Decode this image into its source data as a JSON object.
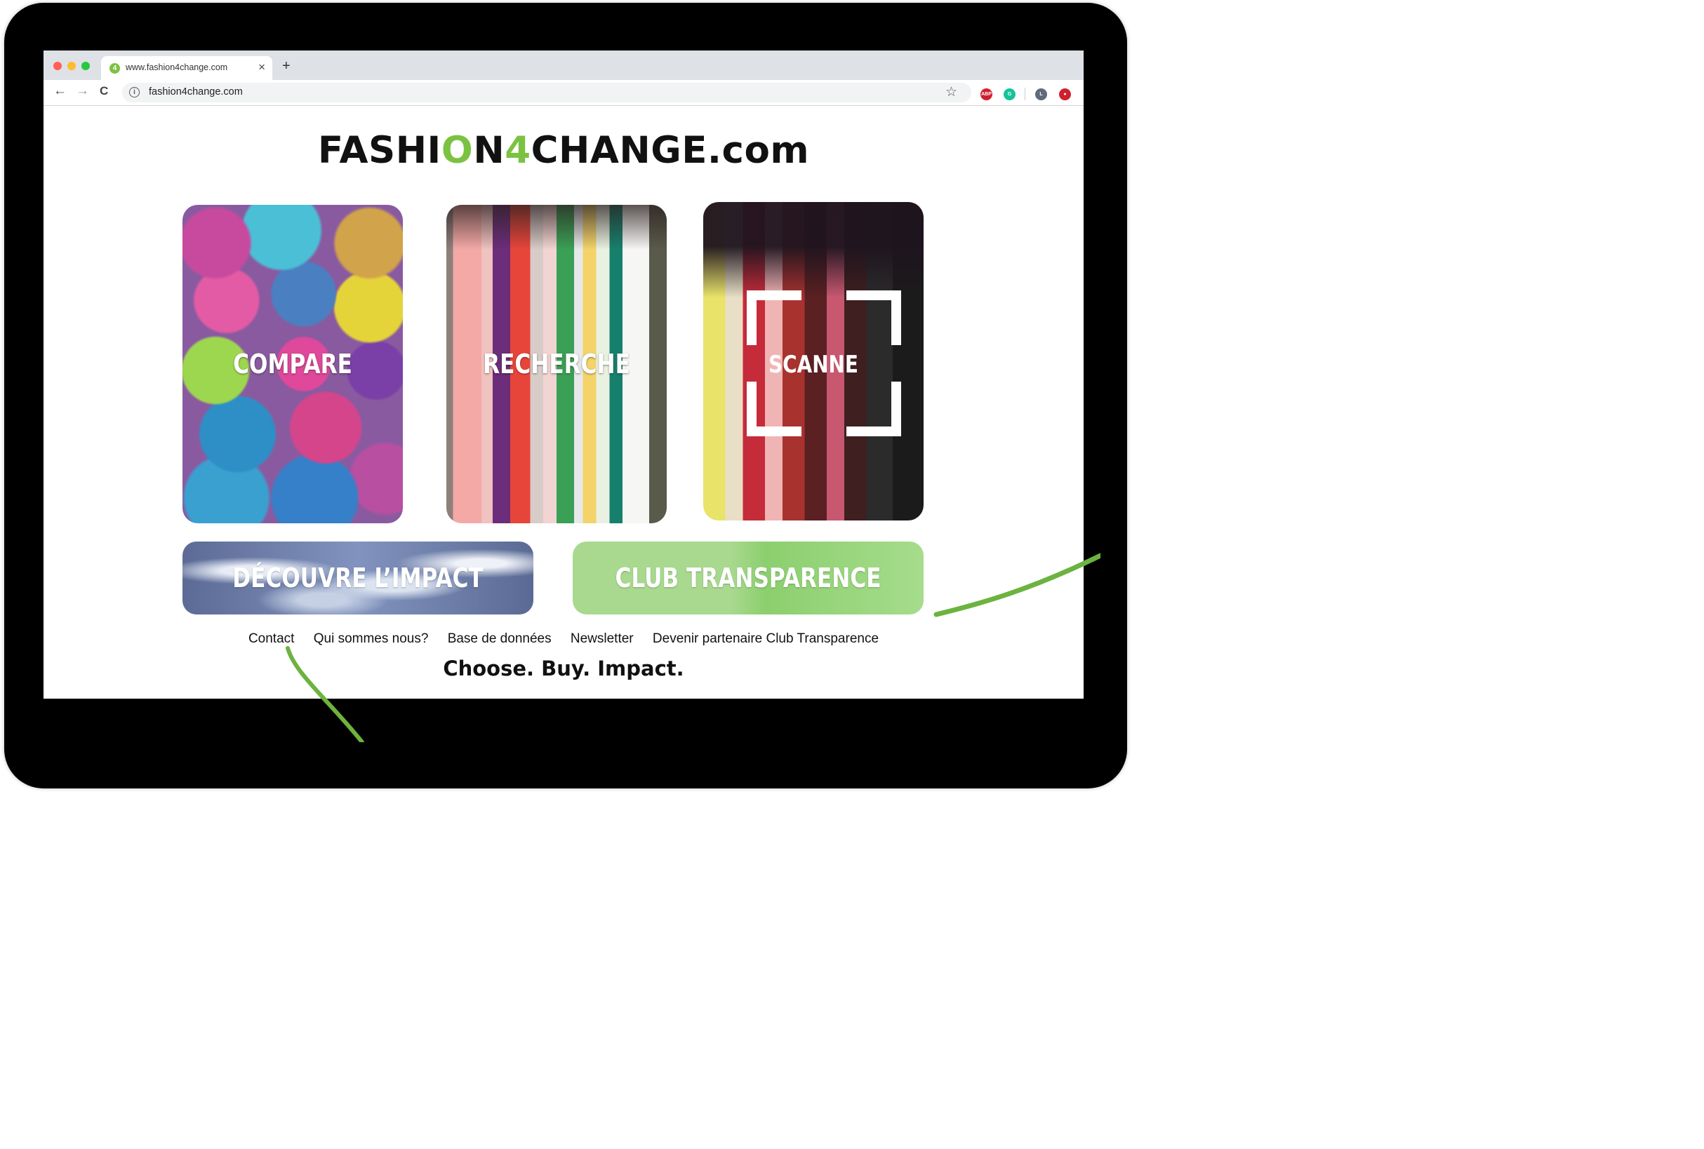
{
  "browser": {
    "tab_title": "www.fashion4change.com",
    "tab_favicon": "4",
    "close_glyph": "×",
    "new_tab_glyph": "+",
    "back_glyph": "←",
    "forward_glyph": "→",
    "reload_glyph": "C",
    "info_glyph": "i",
    "url": "fashion4change.com",
    "star_glyph": "☆",
    "extensions": [
      {
        "name": "adblock-plus-icon",
        "label": "ABP",
        "color": "#d0202e"
      },
      {
        "name": "grammarly-icon",
        "label": "G",
        "color": "#15c39a"
      },
      {
        "name": "profile-avatar-icon",
        "label": "L",
        "color": "#5f6b7a"
      },
      {
        "name": "lastpass-icon",
        "label": "●",
        "color": "#d0202e"
      }
    ]
  },
  "header": {
    "logo_part1": "FASHI",
    "logo_o": "O",
    "logo_part2": "N",
    "logo_four": "4",
    "logo_part3": "CHANGE.com"
  },
  "cards": {
    "compare": "COMPARE",
    "recherche": "RECHERCHE",
    "scanne": "SCANNE",
    "decouvre": "DÉCOUVRE L’IMPACT",
    "club": "CLUB TRANSPARENCE"
  },
  "footer": {
    "links": [
      "Contact",
      "Qui sommes nous?",
      "Base de données",
      "Newsletter",
      "Devenir partenaire Club Transparence"
    ],
    "tagline": "Choose. Buy. Impact."
  },
  "colors": {
    "brand_green": "#7cc242",
    "annotation_green": "#6cb33f"
  }
}
